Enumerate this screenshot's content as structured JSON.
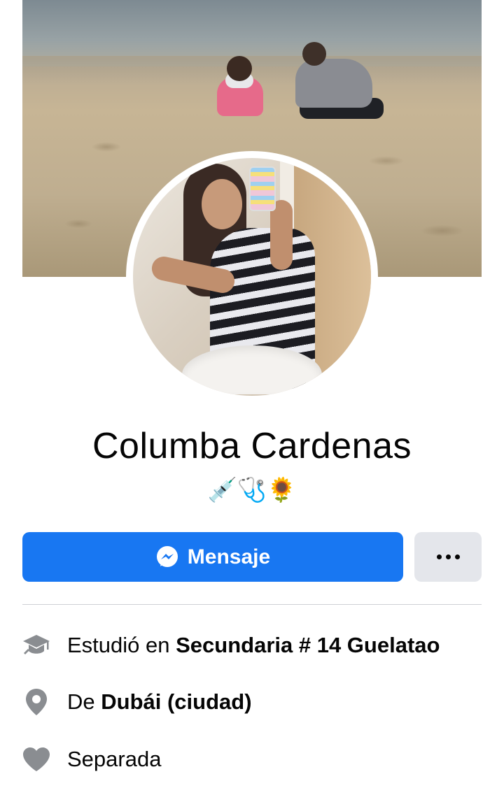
{
  "profile": {
    "name": "Columba Cardenas",
    "bio": "💉🩺🌻"
  },
  "actions": {
    "message_label": "Mensaje",
    "more_label": "···"
  },
  "details": {
    "education": {
      "prefix": "Estudió en ",
      "value": "Secundaria # 14 Guelatao",
      "icon": "graduation-cap-icon"
    },
    "hometown": {
      "prefix": "De ",
      "value": "Dubái (ciudad)",
      "icon": "location-pin-icon"
    },
    "relationship": {
      "value": "Separada",
      "icon": "heart-icon"
    }
  },
  "colors": {
    "primary": "#1877f2",
    "secondary_button": "#e4e6eb",
    "icon_gray": "#8a8d91",
    "text": "#050505"
  }
}
